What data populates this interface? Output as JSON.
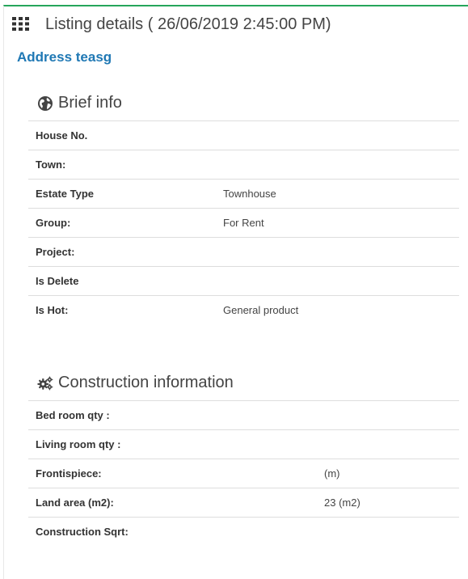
{
  "header": {
    "title": "Listing details ( 26/06/2019 2:45:00 PM)",
    "icon": "grid-icon"
  },
  "address_link": "Address teasg",
  "colors": {
    "accent_border": "#26a65b",
    "link": "#1f78b4"
  },
  "brief_info": {
    "title": "Brief info",
    "icon": "globe-icon",
    "rows": [
      {
        "label": "House No.",
        "value": ""
      },
      {
        "label": "Town:",
        "value": ""
      },
      {
        "label": "Estate Type",
        "value": "Townhouse"
      },
      {
        "label": "Group:",
        "value": "For Rent"
      },
      {
        "label": "Project:",
        "value": ""
      },
      {
        "label": "Is Delete",
        "value": ""
      },
      {
        "label": "Is Hot:",
        "value": "General product"
      }
    ]
  },
  "construction_info": {
    "title": "Construction information",
    "icon": "gears-icon",
    "rows": [
      {
        "label": "Bed room qty :",
        "value": ""
      },
      {
        "label": "Living room qty :",
        "value": ""
      },
      {
        "label": "Frontispiece:",
        "value": "(m)"
      },
      {
        "label": "Land area (m2):",
        "value": "23 (m2)"
      },
      {
        "label": "Construction Sqrt:",
        "value": ""
      }
    ]
  }
}
